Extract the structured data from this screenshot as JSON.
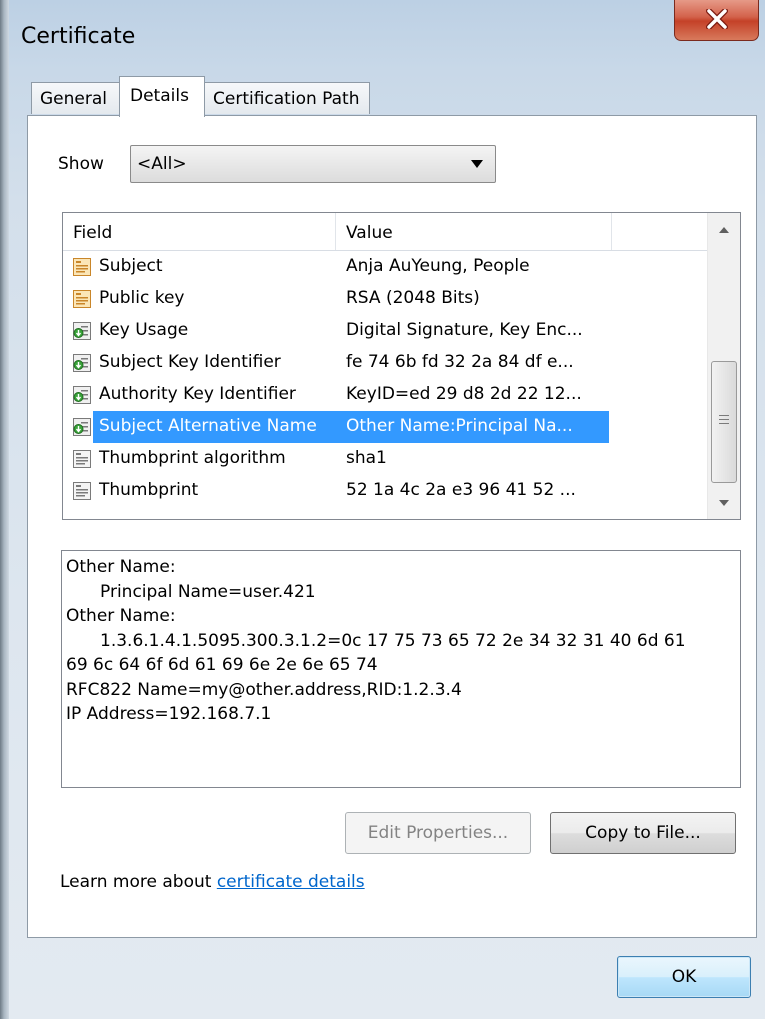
{
  "window": {
    "title": "Certificate",
    "close_icon": "close-icon"
  },
  "tabs": [
    {
      "label": "General",
      "active": false
    },
    {
      "label": "Details",
      "active": true
    },
    {
      "label": "Certification Path",
      "active": false
    }
  ],
  "details": {
    "show_label": "Show",
    "show_value": "<All>",
    "columns": [
      "Field",
      "Value"
    ],
    "rows": [
      {
        "field": "Subject",
        "value": "Anja AuYeung, People",
        "icon": "cert-field-icon"
      },
      {
        "field": "Public key",
        "value": "RSA (2048 Bits)",
        "icon": "cert-field-icon"
      },
      {
        "field": "Key Usage",
        "value": "Digital Signature, Key Enc...",
        "icon": "cert-extension-icon"
      },
      {
        "field": "Subject Key Identifier",
        "value": "fe 74 6b fd 32 2a 84 df e...",
        "icon": "cert-extension-icon"
      },
      {
        "field": "Authority Key Identifier",
        "value": "KeyID=ed 29 d8 2d 22 12...",
        "icon": "cert-extension-icon"
      },
      {
        "field": "Subject Alternative Name",
        "value": "Other Name:Principal Na...",
        "icon": "cert-extension-icon",
        "selected": true
      },
      {
        "field": "Thumbprint algorithm",
        "value": "sha1",
        "icon": "cert-property-icon"
      },
      {
        "field": "Thumbprint",
        "value": "52 1a 4c 2a e3 96 41 52 ...",
        "icon": "cert-property-icon"
      }
    ],
    "detail_text": {
      "line1": "Other Name:",
      "line2": "Principal Name=user.421",
      "line3": "Other Name:",
      "line4": "1.3.6.1.4.1.5095.300.3.1.2=0c 17 75 73 65 72 2e 34 32 31 40 6d 61",
      "line5": "69 6c 64 6f 6d 61 69 6e 2e 6e 65 74",
      "line6": "RFC822 Name=my@other.address,RID:1.2.3.4",
      "line7": "IP Address=192.168.7.1"
    },
    "edit_properties_label": "Edit Properties...",
    "copy_to_file_label": "Copy to File...",
    "learn_more_prefix": "Learn more about ",
    "learn_more_link": "certificate details"
  },
  "footer": {
    "ok_label": "OK"
  }
}
